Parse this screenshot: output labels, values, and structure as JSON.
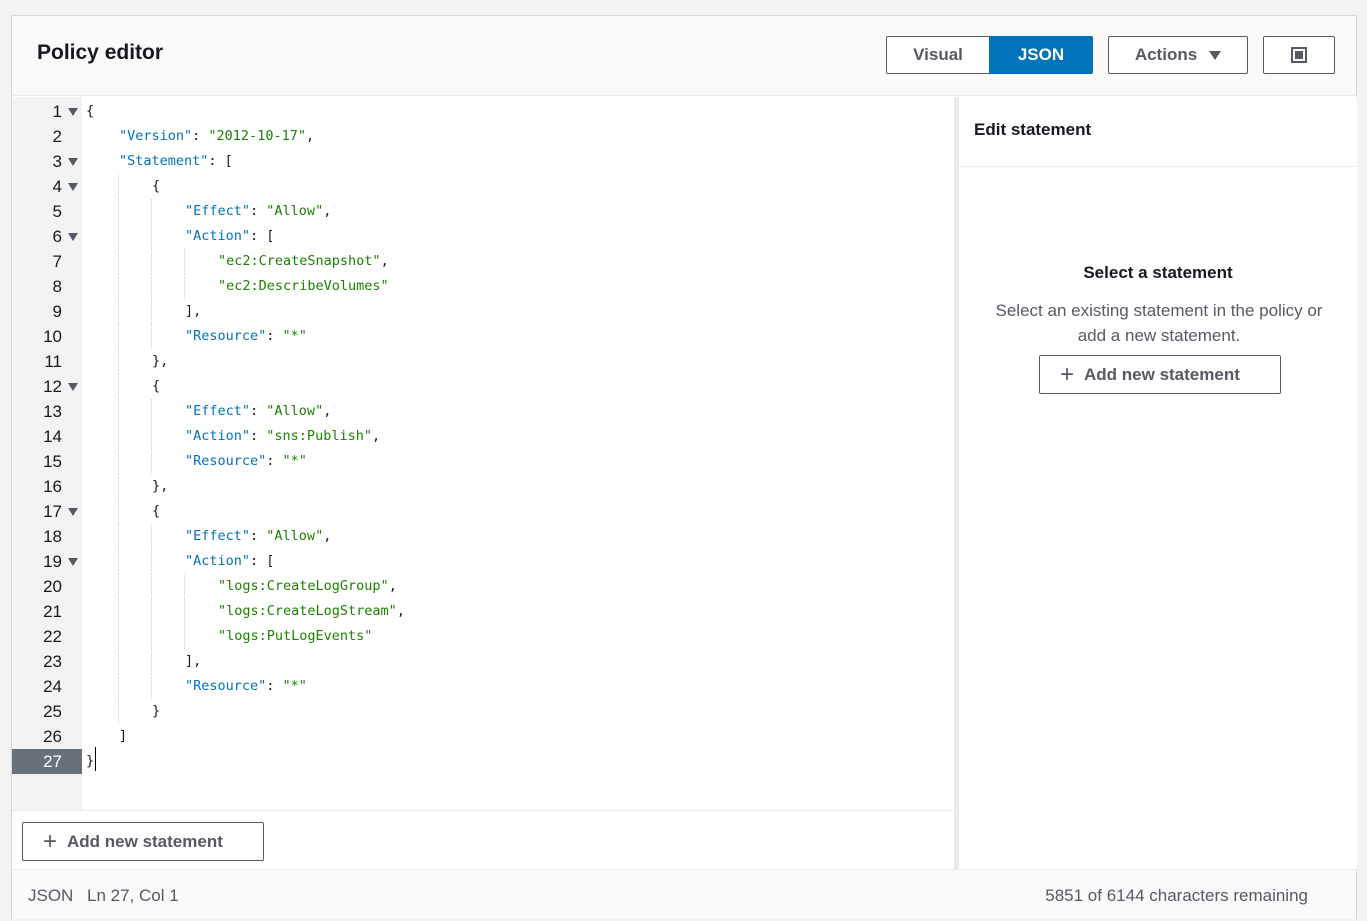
{
  "header": {
    "title": "Policy editor",
    "visual_label": "Visual",
    "json_label": "JSON",
    "actions_label": "Actions"
  },
  "editor": {
    "active_line": 27,
    "lines": [
      {
        "n": "1",
        "fold": true,
        "indent": 0,
        "tokens": [
          [
            "p",
            "{"
          ]
        ]
      },
      {
        "n": "2",
        "fold": false,
        "indent": 1,
        "tokens": [
          [
            "k",
            "\"Version\""
          ],
          [
            "p",
            ": "
          ],
          [
            "s",
            "\"2012-10-17\""
          ],
          [
            "p",
            ","
          ]
        ]
      },
      {
        "n": "3",
        "fold": true,
        "indent": 1,
        "tokens": [
          [
            "k",
            "\"Statement\""
          ],
          [
            "p",
            ": ["
          ]
        ]
      },
      {
        "n": "4",
        "fold": true,
        "indent": 2,
        "tokens": [
          [
            "p",
            "{"
          ]
        ]
      },
      {
        "n": "5",
        "fold": false,
        "indent": 3,
        "tokens": [
          [
            "k",
            "\"Effect\""
          ],
          [
            "p",
            ": "
          ],
          [
            "s",
            "\"Allow\""
          ],
          [
            "p",
            ","
          ]
        ]
      },
      {
        "n": "6",
        "fold": true,
        "indent": 3,
        "tokens": [
          [
            "k",
            "\"Action\""
          ],
          [
            "p",
            ": ["
          ]
        ]
      },
      {
        "n": "7",
        "fold": false,
        "indent": 4,
        "tokens": [
          [
            "s",
            "\"ec2:CreateSnapshot\""
          ],
          [
            "p",
            ","
          ]
        ]
      },
      {
        "n": "8",
        "fold": false,
        "indent": 4,
        "tokens": [
          [
            "s",
            "\"ec2:DescribeVolumes\""
          ]
        ]
      },
      {
        "n": "9",
        "fold": false,
        "indent": 3,
        "tokens": [
          [
            "p",
            "],"
          ]
        ]
      },
      {
        "n": "10",
        "fold": false,
        "indent": 3,
        "tokens": [
          [
            "k",
            "\"Resource\""
          ],
          [
            "p",
            ": "
          ],
          [
            "s",
            "\"*\""
          ]
        ]
      },
      {
        "n": "11",
        "fold": false,
        "indent": 2,
        "tokens": [
          [
            "p",
            "},"
          ]
        ]
      },
      {
        "n": "12",
        "fold": true,
        "indent": 2,
        "tokens": [
          [
            "p",
            "{"
          ]
        ]
      },
      {
        "n": "13",
        "fold": false,
        "indent": 3,
        "tokens": [
          [
            "k",
            "\"Effect\""
          ],
          [
            "p",
            ": "
          ],
          [
            "s",
            "\"Allow\""
          ],
          [
            "p",
            ","
          ]
        ]
      },
      {
        "n": "14",
        "fold": false,
        "indent": 3,
        "tokens": [
          [
            "k",
            "\"Action\""
          ],
          [
            "p",
            ": "
          ],
          [
            "s",
            "\"sns:Publish\""
          ],
          [
            "p",
            ","
          ]
        ]
      },
      {
        "n": "15",
        "fold": false,
        "indent": 3,
        "tokens": [
          [
            "k",
            "\"Resource\""
          ],
          [
            "p",
            ": "
          ],
          [
            "s",
            "\"*\""
          ]
        ]
      },
      {
        "n": "16",
        "fold": false,
        "indent": 2,
        "tokens": [
          [
            "p",
            "},"
          ]
        ]
      },
      {
        "n": "17",
        "fold": true,
        "indent": 2,
        "tokens": [
          [
            "p",
            "{"
          ]
        ]
      },
      {
        "n": "18",
        "fold": false,
        "indent": 3,
        "tokens": [
          [
            "k",
            "\"Effect\""
          ],
          [
            "p",
            ": "
          ],
          [
            "s",
            "\"Allow\""
          ],
          [
            "p",
            ","
          ]
        ]
      },
      {
        "n": "19",
        "fold": true,
        "indent": 3,
        "tokens": [
          [
            "k",
            "\"Action\""
          ],
          [
            "p",
            ": ["
          ]
        ]
      },
      {
        "n": "20",
        "fold": false,
        "indent": 4,
        "tokens": [
          [
            "s",
            "\"logs:CreateLogGroup\""
          ],
          [
            "p",
            ","
          ]
        ]
      },
      {
        "n": "21",
        "fold": false,
        "indent": 4,
        "tokens": [
          [
            "s",
            "\"logs:CreateLogStream\""
          ],
          [
            "p",
            ","
          ]
        ]
      },
      {
        "n": "22",
        "fold": false,
        "indent": 4,
        "tokens": [
          [
            "s",
            "\"logs:PutLogEvents\""
          ]
        ]
      },
      {
        "n": "23",
        "fold": false,
        "indent": 3,
        "tokens": [
          [
            "p",
            "],"
          ]
        ]
      },
      {
        "n": "24",
        "fold": false,
        "indent": 3,
        "tokens": [
          [
            "k",
            "\"Resource\""
          ],
          [
            "p",
            ": "
          ],
          [
            "s",
            "\"*\""
          ]
        ]
      },
      {
        "n": "25",
        "fold": false,
        "indent": 2,
        "tokens": [
          [
            "p",
            "}"
          ]
        ]
      },
      {
        "n": "26",
        "fold": false,
        "indent": 1,
        "tokens": [
          [
            "p",
            "]"
          ]
        ]
      },
      {
        "n": "27",
        "fold": false,
        "indent": 0,
        "tokens": [
          [
            "p",
            "}"
          ]
        ]
      }
    ],
    "add_statement_label": "Add new statement"
  },
  "side": {
    "title": "Edit statement",
    "empty_title": "Select a statement",
    "empty_desc": "Select an existing statement in the policy or add a new statement.",
    "add_statement_label": "Add new statement"
  },
  "status": {
    "mode": "JSON",
    "position": "Ln 27, Col 1",
    "remaining": "5851 of 6144 characters remaining"
  }
}
